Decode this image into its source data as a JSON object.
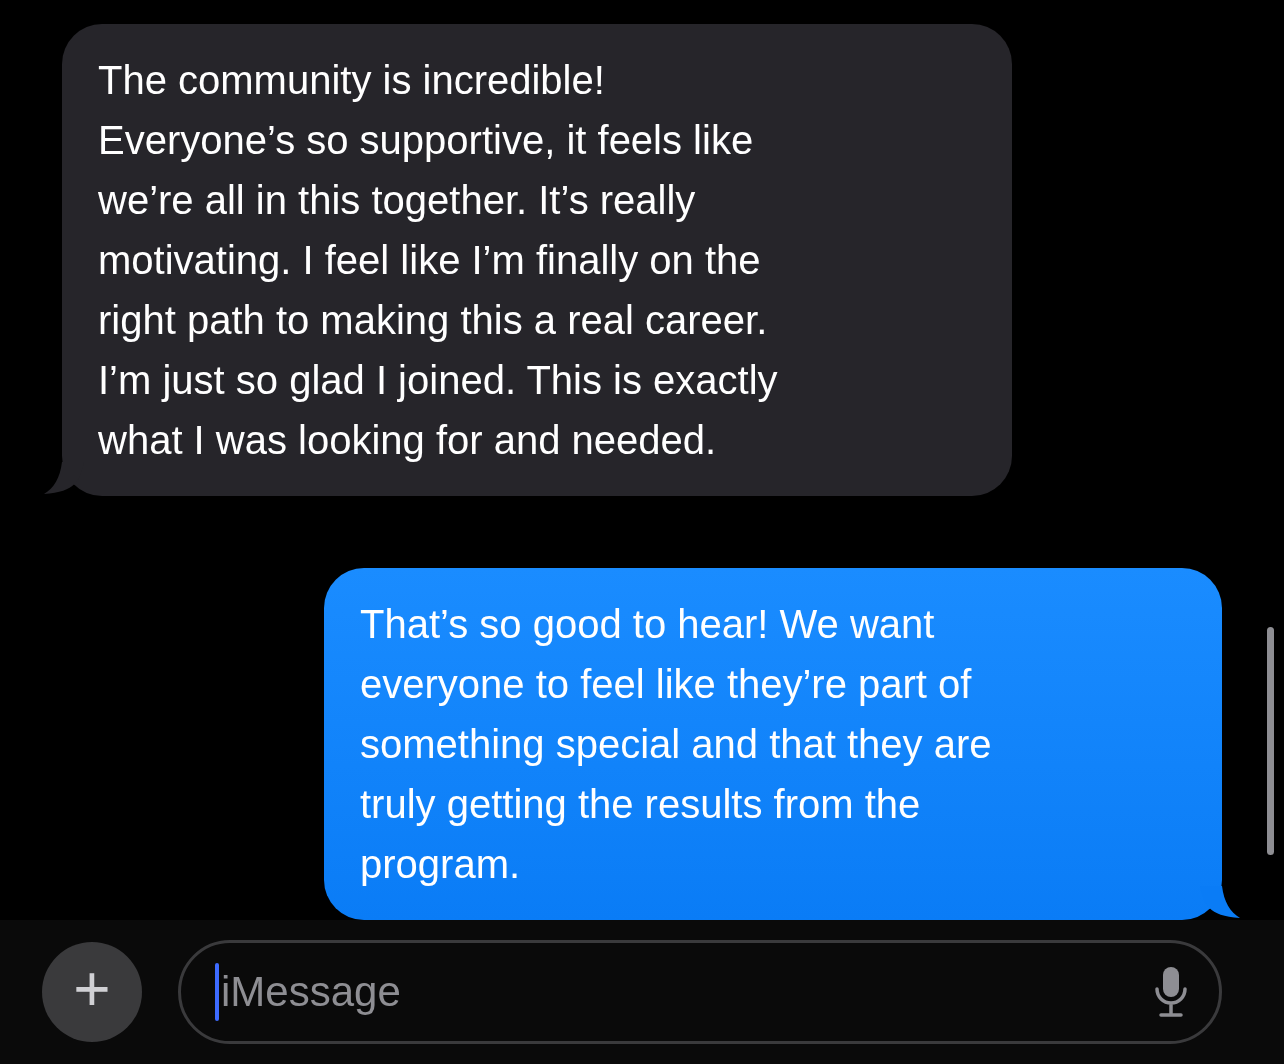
{
  "messages": [
    {
      "kind": "received",
      "text": "The community is incredible!\nEveryone’s so supportive, it feels like\nwe’re all in this together. It’s really\nmotivating. I feel like I’m finally on the\nright path to making this a real career.\nI’m just so glad I joined. This is exactly\nwhat I was looking for and needed."
    },
    {
      "kind": "sent",
      "text": "That’s so good to hear! We want\neveryone to feel like they’re part of\nsomething special and that they are\ntruly getting the results from the\nprogram."
    }
  ],
  "composer": {
    "add_button": "+",
    "placeholder": "iMessage"
  }
}
